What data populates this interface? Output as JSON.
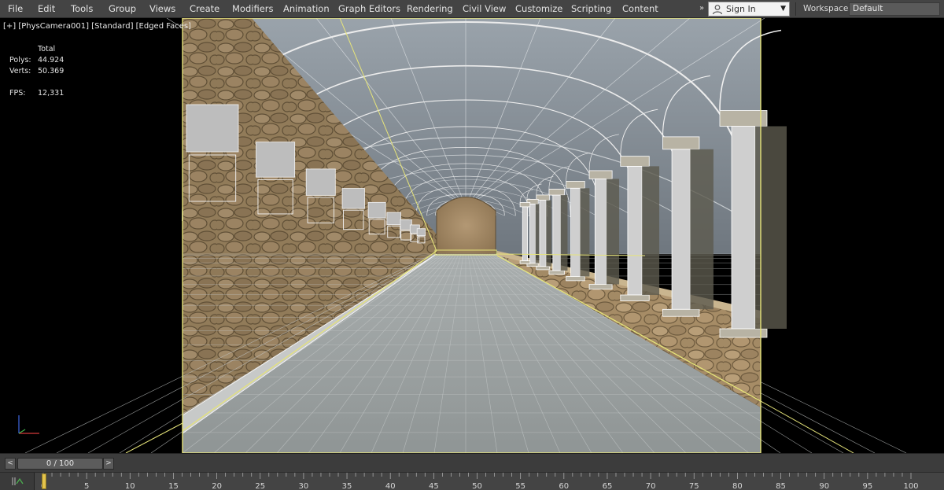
{
  "menu": {
    "items": [
      "File",
      "Edit",
      "Tools",
      "Group",
      "Views",
      "Create",
      "Modifiers",
      "Animation",
      "Graph Editors",
      "Rendering",
      "Civil View",
      "Customize",
      "Scripting",
      "Content"
    ],
    "overflow_glyph": "»",
    "signin_label": "Sign In",
    "signin_icon": "user-icon",
    "dropdown_glyph": "▼",
    "workspaces_label": "Workspaces:",
    "workspace_value": "Default"
  },
  "viewport": {
    "label": "[+] [PhysCamera001] [Standard] [Edged Faces]",
    "stats": {
      "header": "Total",
      "polys_label": "Polys:",
      "polys_value": "44.924",
      "verts_label": "Verts:",
      "verts_value": "50.369",
      "fps_label": "FPS:",
      "fps_value": "12,331"
    },
    "axis_icon": "axis-tripod-icon"
  },
  "timeline": {
    "prev_glyph": "<",
    "next_glyph": ">",
    "frame_display": "0 / 100",
    "current_frame": 0,
    "total_frames": 100,
    "ruler_labels": [
      "0",
      "5",
      "10",
      "15",
      "20",
      "25",
      "30",
      "35",
      "40",
      "45",
      "50",
      "55",
      "60",
      "65",
      "70",
      "75",
      "80",
      "85",
      "90",
      "95",
      "100"
    ],
    "track_icon": "curve-editor-icon"
  },
  "colors": {
    "menu_bg": "#444444",
    "selection_yellow": "#e6e47a",
    "stone_wall": "#a58c66",
    "floor_tile": "#9ea3a3",
    "vault_gray": "#8d97a0",
    "frame_marker": "#e3c34c"
  }
}
